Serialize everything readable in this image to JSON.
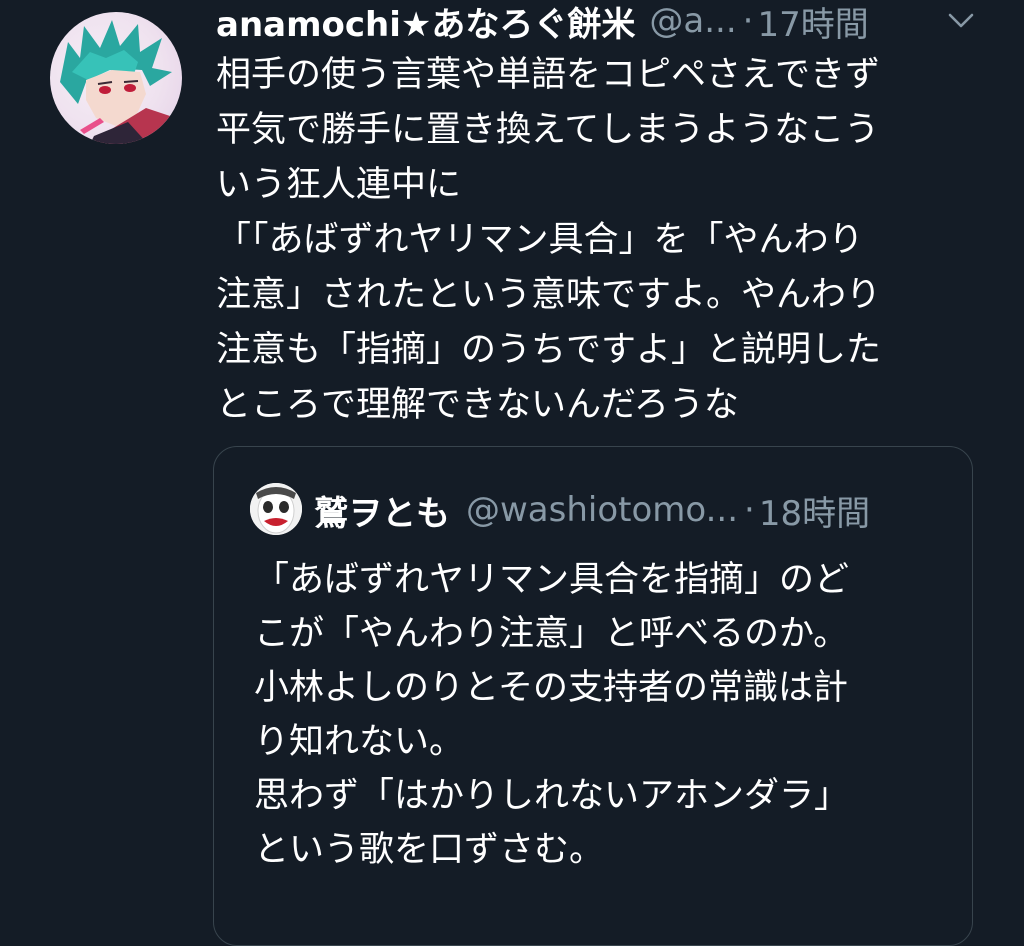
{
  "tweet": {
    "display_name": "anamochi★あなろぐ餅米",
    "handle": "@a...",
    "separator": "·",
    "time": "17時間",
    "chevron_icon": "chevron-down-icon",
    "text": "相手の使う言葉や単語をコピペさえできず\n平気で勝手に置き換えてしまうようなこう\nいう狂人連中に\n「「あばずれヤリマン具合」を「やんわり\n注意」されたという意味ですよ。やんわり\n注意も「指摘」のうちですよ」と説明した\nところで理解できないんだろうな"
  },
  "quote": {
    "display_name": "鷲ヲとも",
    "handle": "@washiotomo...",
    "separator": "·",
    "time": "18時間",
    "text": "「あばずれヤリマン具合を指摘」のど\nこが「やんわり注意」と呼べるのか。\n小林よしのりとその支持者の常識は計\nり知れない。\n思わず「はかりしれないアホンダラ」\nという歌を口ずさむ。"
  },
  "colors": {
    "background": "#141c26",
    "text": "#ffffff",
    "secondary_text": "#8899a6",
    "border": "#38444d"
  }
}
